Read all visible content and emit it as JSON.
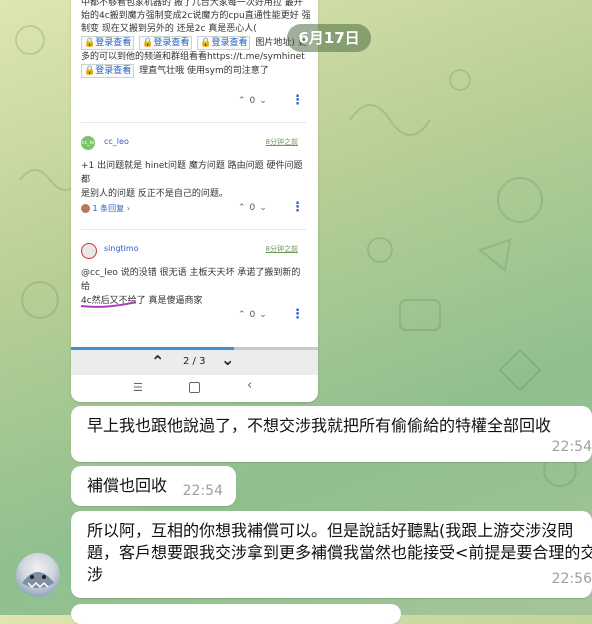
{
  "date_pill": "6月17日",
  "card": {
    "top_text_line1": "中都不够看包家机器的 搬了几台大家每一次好用拉 最开",
    "top_text_line2": "始的4c搬到魔方强制变成2c说魔方的cpu直通性能更好 强",
    "top_text_line3": "制变 现在又搬到另外的 还是2c 真是恶心人(",
    "login_label": "登录查看",
    "image_link_label": "图片地址) 更",
    "top_text_line4": "多的可以到他的频道和群组看看https://t.me/symhinet",
    "top_text_line5_suffix": "理直气壮哦 使用sym的司注意了",
    "posts": [
      {
        "user": "cc_leo",
        "avatar_text": "cc_le",
        "time": "8分钟之前",
        "text_line1": "+1 出问题就是 hinet问题 魔方问题 路由问题 硬件问题 都",
        "text_line2": "是别人的问题 反正不是自己的问题。",
        "replies": "1 条回复",
        "votes": "0"
      },
      {
        "user": "singtimo",
        "time": "8分钟之前",
        "text_line1": "@cc_leo 说的没错 很无语 主板天天坏 承诺了搬到新的给",
        "text_line2": "4c然后又不给了 真是傻逼商家",
        "votes": "0"
      }
    ],
    "top_votes": "0",
    "pager_text": "2 / 3"
  },
  "messages": [
    {
      "text": "早上我也跟他說過了，不想交涉我就把所有偷偷給的特權全部回收",
      "time": "22:54"
    },
    {
      "text": "補償也回收",
      "time": "22:54"
    },
    {
      "text_line1": "所以阿，互相的你想我補償可以。但是說話好聽點(我跟上游交涉沒問",
      "text_line2": "題，客戶想要跟我交涉拿到更多補償我當然也能接受<前提是要合理的交",
      "text_line3": "涉",
      "time": "22:56"
    }
  ],
  "colors": {
    "accent_blue": "#2a5cc8",
    "pager_fill": "#3e8fd8",
    "time_green": "#6a9a55"
  }
}
